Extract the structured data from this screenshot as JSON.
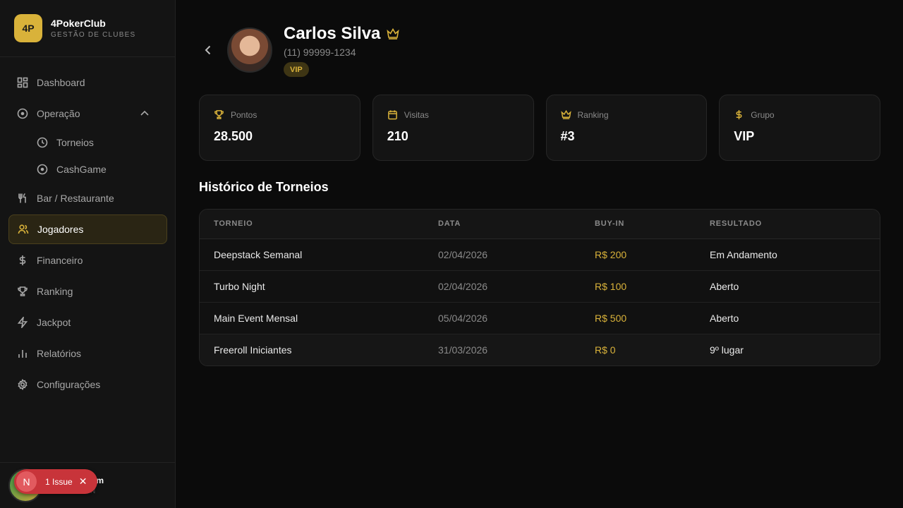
{
  "brand": {
    "logo": "4P",
    "name": "4PokerClub",
    "subtitle": "GESTÃO DE CLUBES"
  },
  "nav": {
    "dashboard": "Dashboard",
    "operacao": "Operação",
    "torneios": "Torneios",
    "cashgame": "CashGame",
    "bar": "Bar / Restaurante",
    "jogadores": "Jogadores",
    "financeiro": "Financeiro",
    "ranking": "Ranking",
    "jackpot": "Jackpot",
    "relatorios": "Relatórios",
    "configuracoes": "Configurações"
  },
  "footer_user": {
    "name_fragment": "im",
    "role_fragment": "N"
  },
  "issue": {
    "icon_letter": "N",
    "label": "1 Issue"
  },
  "player": {
    "name": "Carlos Silva",
    "phone": "(11) 99999-1234",
    "badge": "VIP"
  },
  "stats": [
    {
      "label": "Pontos",
      "value": "28.500",
      "icon": "trophy-icon"
    },
    {
      "label": "Visitas",
      "value": "210",
      "icon": "calendar-icon"
    },
    {
      "label": "Ranking",
      "value": "#3",
      "icon": "crown-icon"
    },
    {
      "label": "Grupo",
      "value": "VIP",
      "icon": "dollar-icon"
    }
  ],
  "history": {
    "title": "Histórico de Torneios",
    "columns": [
      "TORNEIO",
      "DATA",
      "BUY-IN",
      "RESULTADO"
    ],
    "rows": [
      [
        "Deepstack Semanal",
        "02/04/2026",
        "R$ 200",
        "Em Andamento"
      ],
      [
        "Turbo Night",
        "02/04/2026",
        "R$ 100",
        "Aberto"
      ],
      [
        "Main Event Mensal",
        "05/04/2026",
        "R$ 500",
        "Aberto"
      ],
      [
        "Freeroll Iniciantes",
        "31/03/2026",
        "R$ 0",
        "9º lugar"
      ]
    ]
  },
  "colors": {
    "accent": "#d9b23a",
    "background": "#0b0b0b",
    "sidebar": "#141414",
    "issue": "#c8343a"
  }
}
